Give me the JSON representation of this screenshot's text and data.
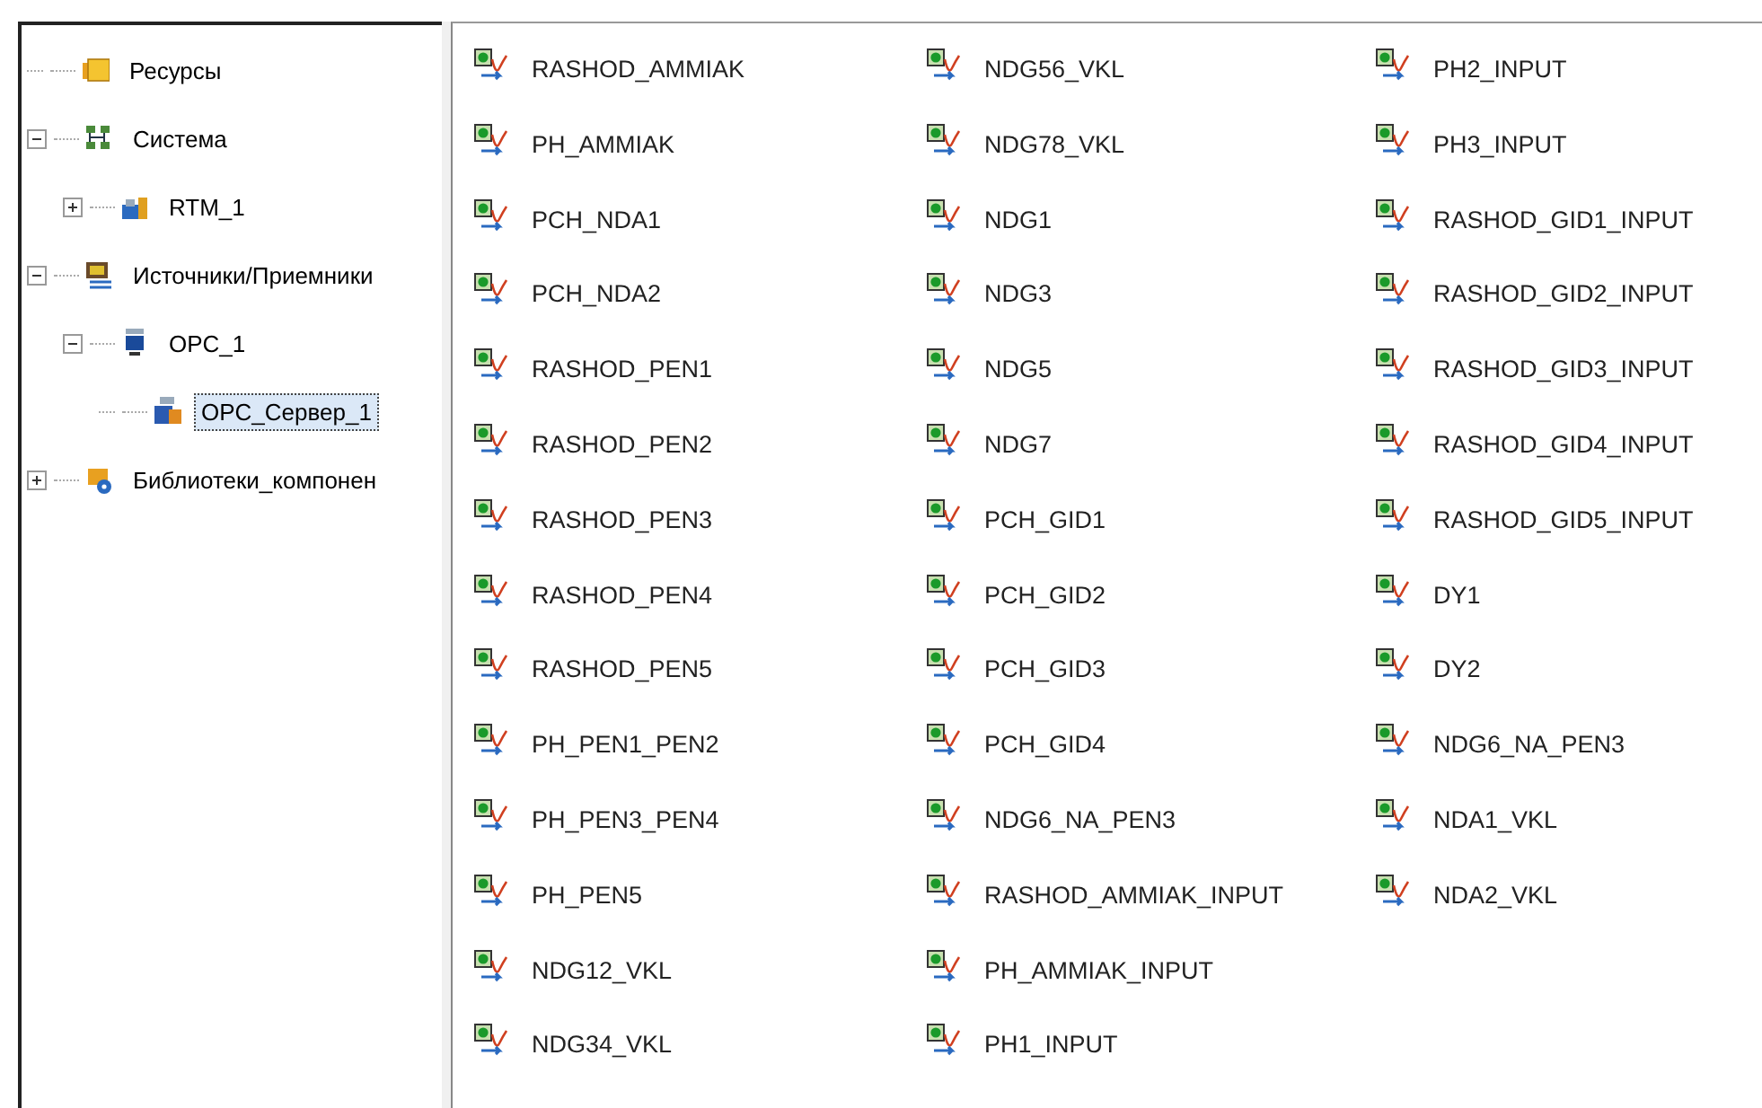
{
  "tree": [
    {
      "label": "Ресурсы",
      "kind": "resources",
      "selected": false
    },
    {
      "label": "Система",
      "kind": "system",
      "expanded": true,
      "selected": false,
      "children": [
        {
          "label": "RTM_1",
          "kind": "rtm",
          "expanded": false,
          "selected": false
        }
      ]
    },
    {
      "label": "Источники/Приемники",
      "kind": "io",
      "expanded": true,
      "selected": false,
      "children": [
        {
          "label": "OPC_1",
          "kind": "opc",
          "expanded": true,
          "selected": false,
          "children": [
            {
              "label": "OPC_Сервер_1",
              "kind": "server",
              "selected": true
            }
          ]
        }
      ]
    },
    {
      "label": "Библиотеки_компонен",
      "kind": "library",
      "expanded": false,
      "selected": false
    }
  ],
  "items": [
    "RASHOD_AMMIAK",
    "PH_AMMIAK",
    "PCH_NDA1",
    "PCH_NDA2",
    "RASHOD_PEN1",
    "RASHOD_PEN2",
    "RASHOD_PEN3",
    "RASHOD_PEN4",
    "RASHOD_PEN5",
    "PH_PEN1_PEN2",
    "PH_PEN3_PEN4",
    "PH_PEN5",
    "NDG12_VKL",
    "NDG34_VKL",
    "NDG56_VKL",
    "NDG78_VKL",
    "NDG1",
    "NDG3",
    "NDG5",
    "NDG7",
    "PCH_GID1",
    "PCH_GID2",
    "PCH_GID3",
    "PCH_GID4",
    "NDG6_NA_PEN3",
    "RASHOD_AMMIAK_INPUT",
    "PH_AMMIAK_INPUT",
    "PH1_INPUT",
    "PH2_INPUT",
    "PH3_INPUT",
    "RASHOD_GID1_INPUT",
    "RASHOD_GID2_INPUT",
    "RASHOD_GID3_INPUT",
    "RASHOD_GID4_INPUT",
    "RASHOD_GID5_INPUT",
    "DY1",
    "DY2",
    "NDG6_NA_PEN3",
    "NDA1_VKL",
    "NDA2_VKL"
  ]
}
